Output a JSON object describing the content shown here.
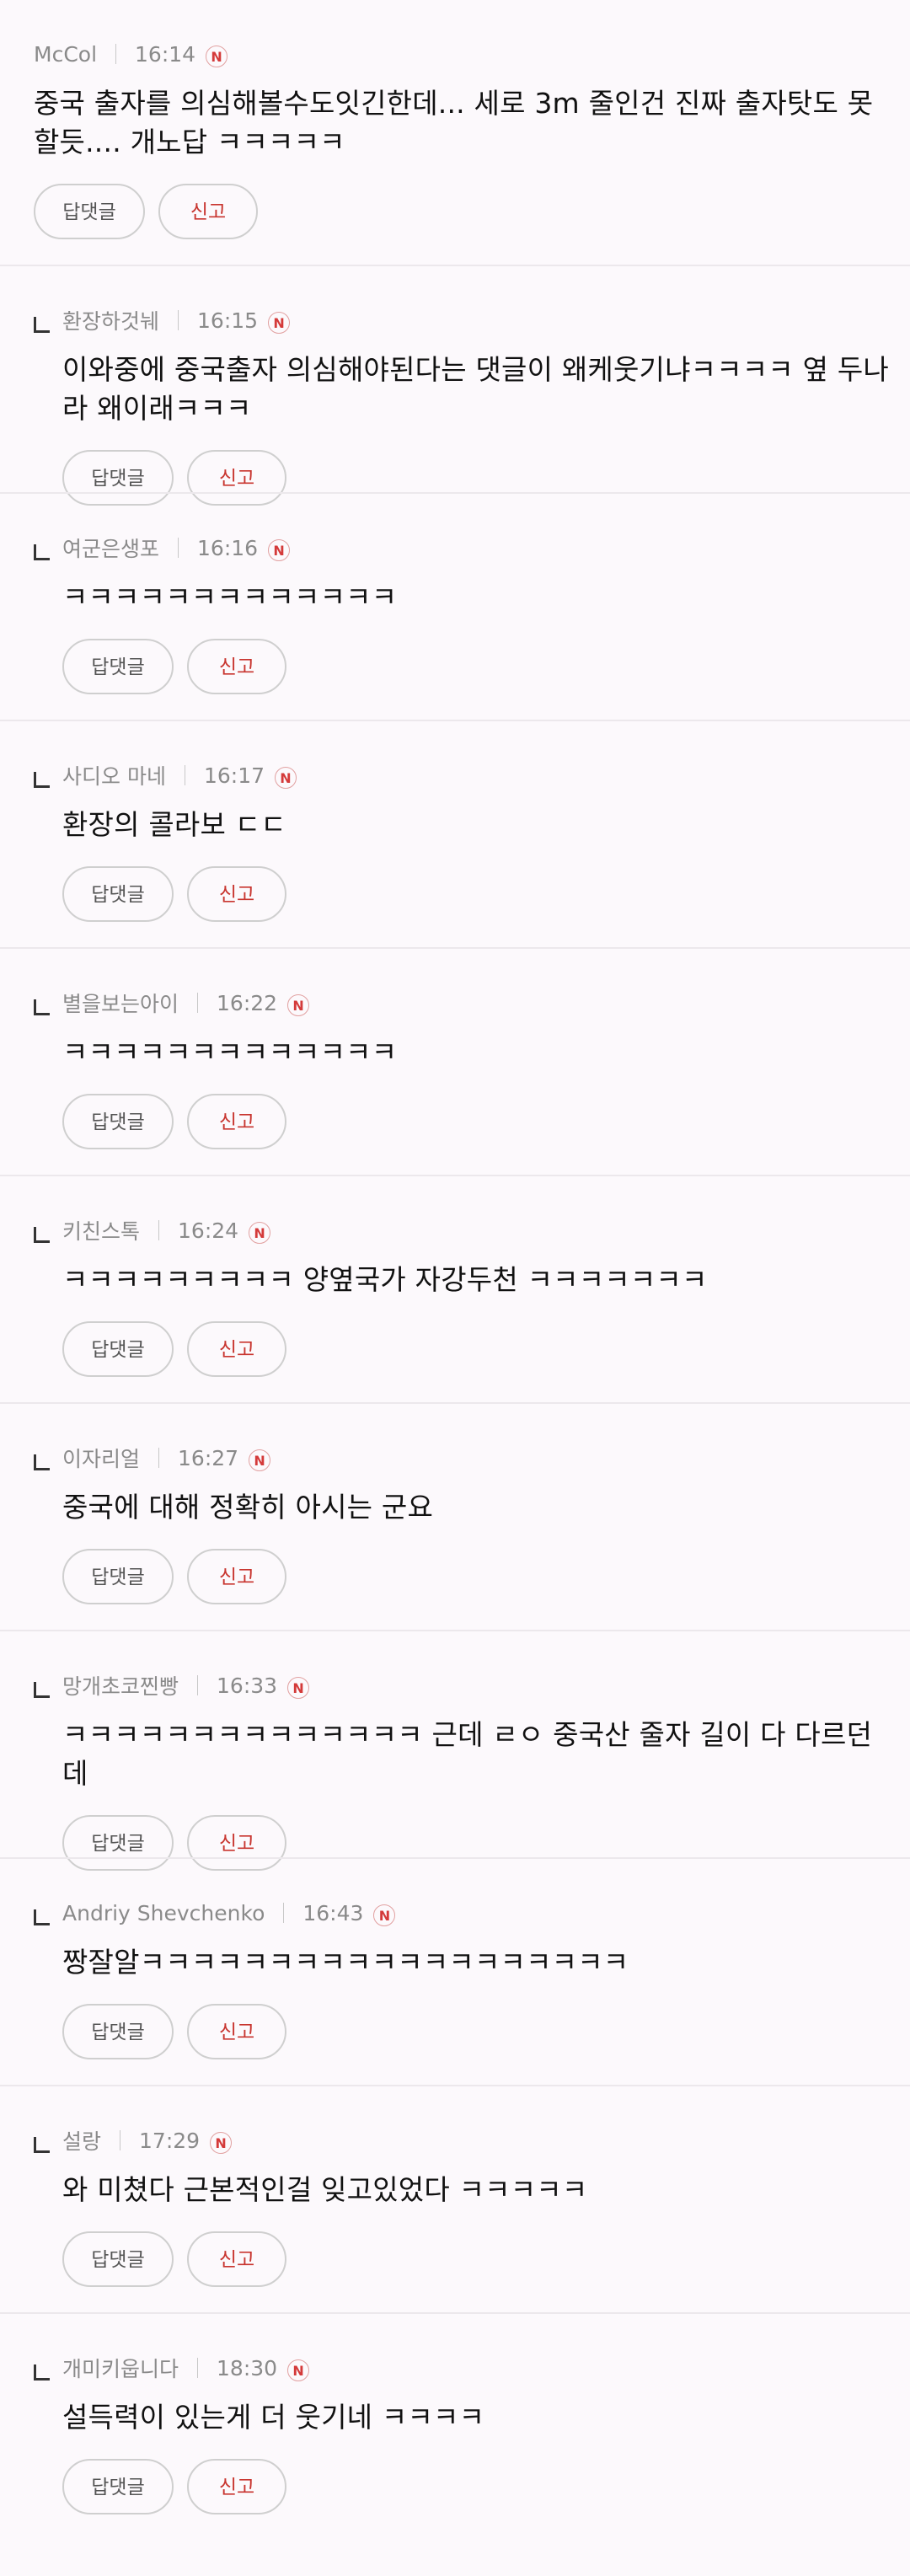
{
  "buttons": {
    "reply": "답댓글",
    "report": "신고"
  },
  "new_badge": "N",
  "colors": {
    "report": "#c8352f",
    "badge": "#d43a3a",
    "background": "#fcf9fc"
  },
  "comments": [
    {
      "author": "McCol",
      "time": "16:14",
      "text": "중국 출자를 의심해볼수도잇긴한데... 세로 3m 줄인건 진짜 출자탓도 못할듯.... 개노답 ㅋㅋㅋㅋㅋ",
      "is_reply": false
    },
    {
      "author": "환장하것눼",
      "time": "16:15",
      "text": "이와중에 중국출자 의심해야된다는 댓글이 왜케웃기냐ㅋㅋㅋㅋ 옆 두나라 왜이래ㅋㅋㅋ",
      "is_reply": true
    },
    {
      "author": "여군은생포",
      "time": "16:16",
      "text": "ㅋㅋㅋㅋㅋㅋㅋㅋㅋㅋㅋㅋㅋ",
      "is_reply": true
    },
    {
      "author": "사디오 마네",
      "time": "16:17",
      "text": "환장의 콜라보 ㄷㄷ",
      "is_reply": true
    },
    {
      "author": "별을보는아이",
      "time": "16:22",
      "text": "ㅋㅋㅋㅋㅋㅋㅋㅋㅋㅋㅋㅋㅋ",
      "is_reply": true
    },
    {
      "author": "키친스톡",
      "time": "16:24",
      "text": "ㅋㅋㅋㅋㅋㅋㅋㅋㅋ 양옆국가 자강두천 ㅋㅋㅋㅋㅋㅋㅋ",
      "is_reply": true
    },
    {
      "author": "이자리얼",
      "time": "16:27",
      "text": "중국에 대해 정확히 아시는 군요",
      "is_reply": true
    },
    {
      "author": "망개초코찐빵",
      "time": "16:33",
      "text": "ㅋㅋㅋㅋㅋㅋㅋㅋㅋㅋㅋㅋㅋㅋ 근데 ㄹㅇ 중국산 줄자 길이 다 다르던데",
      "is_reply": true
    },
    {
      "author": "Andriy Shevchenko",
      "time": "16:43",
      "text": "짱잘알ㅋㅋㅋㅋㅋㅋㅋㅋㅋㅋㅋㅋㅋㅋㅋㅋㅋㅋㅋ",
      "is_reply": true
    },
    {
      "author": "설랑",
      "time": "17:29",
      "text": "와 미쳤다 근본적인걸 잊고있었다 ㅋㅋㅋㅋㅋ",
      "is_reply": true
    },
    {
      "author": "개미키웁니다",
      "time": "18:30",
      "text": "설득력이 있는게 더 웃기네 ㅋㅋㅋㅋ",
      "is_reply": true
    }
  ]
}
